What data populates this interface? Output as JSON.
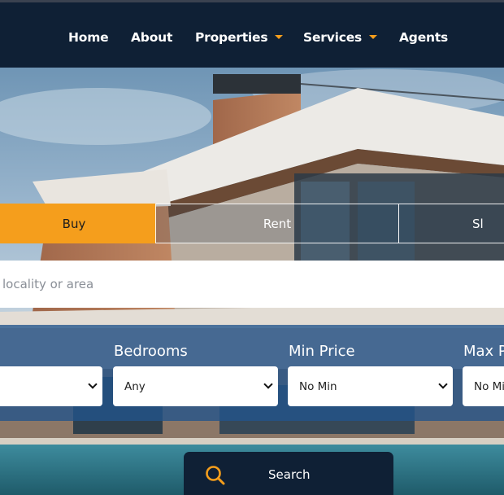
{
  "nav": {
    "items": [
      {
        "label": "Home",
        "dropdown": false
      },
      {
        "label": "About",
        "dropdown": false
      },
      {
        "label": "Properties",
        "dropdown": true
      },
      {
        "label": "Services",
        "dropdown": true
      },
      {
        "label": "Agents",
        "dropdown": false
      }
    ]
  },
  "tabs": {
    "buy": "Buy",
    "rent": "Rent",
    "sell": "Sl",
    "active": "buy"
  },
  "search": {
    "placeholder": "locality or area"
  },
  "filters": {
    "first_value": "",
    "bedrooms_label": "Bedrooms",
    "bedrooms_value": "Any",
    "min_price_label": "Min Price",
    "min_price_value": "No Min",
    "max_price_label": "Max P",
    "max_price_value": "No Mi"
  },
  "search_button": {
    "label": "Search"
  },
  "colors": {
    "accent": "#f59e1c",
    "navy": "#0f2035",
    "filter_panel": "#21538c"
  },
  "icons": {
    "search": "search-icon",
    "dropdown": "chevron-down-icon",
    "nav_dropdown": "caret-down-icon"
  }
}
